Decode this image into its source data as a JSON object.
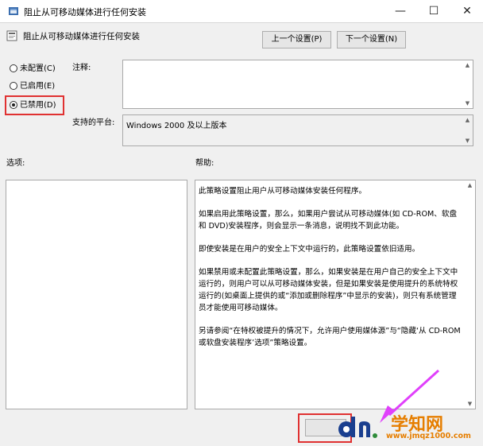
{
  "window": {
    "title": "阻止从可移动媒体进行任何安装",
    "minimize_glyph": "—",
    "maximize_glyph": "☐",
    "close_glyph": "✕"
  },
  "header": {
    "policy_title": "阻止从可移动媒体进行任何安装",
    "prev_button": "上一个设置(P)",
    "next_button": "下一个设置(N)"
  },
  "state": {
    "not_configured": "未配置(C)",
    "enabled": "已启用(E)",
    "disabled": "已禁用(D)",
    "selected": "disabled"
  },
  "labels": {
    "comment": "注释:",
    "supported_on": "支持的平台:",
    "options": "选项:",
    "help": "帮助:"
  },
  "supported_platform": "Windows 2000 及以上版本",
  "help_paragraphs": [
    "此策略设置阻止用户从可移动媒体安装任何程序。",
    "如果启用此策略设置，那么，如果用户尝试从可移动媒体(如 CD-ROM、软盘和 DVD)安装程序，则会显示一条消息，说明找不到此功能。",
    "即使安装是在用户的安全上下文中运行的，此策略设置依旧适用。",
    "如果禁用或未配置此策略设置，那么，如果安装是在用户自己的安全上下文中运行的，则用户可以从可移动媒体安装，但是如果安装是使用提升的系统特权运行的(如桌面上提供的或“添加或删除程序”中显示的安装)，则只有系统管理员才能使用可移动媒体。",
    "另请参阅“在特权被提升的情况下，允许用户使用媒体源”与“隐藏‘从 CD-ROM 或软盘安装程序’选项”策略设置。"
  ],
  "watermark": {
    "brand": "学知网",
    "url": "www.jmqz1000.com"
  },
  "colors": {
    "highlight": "#e03131",
    "arrow": "#e040fb",
    "brand": "#e67e00"
  }
}
